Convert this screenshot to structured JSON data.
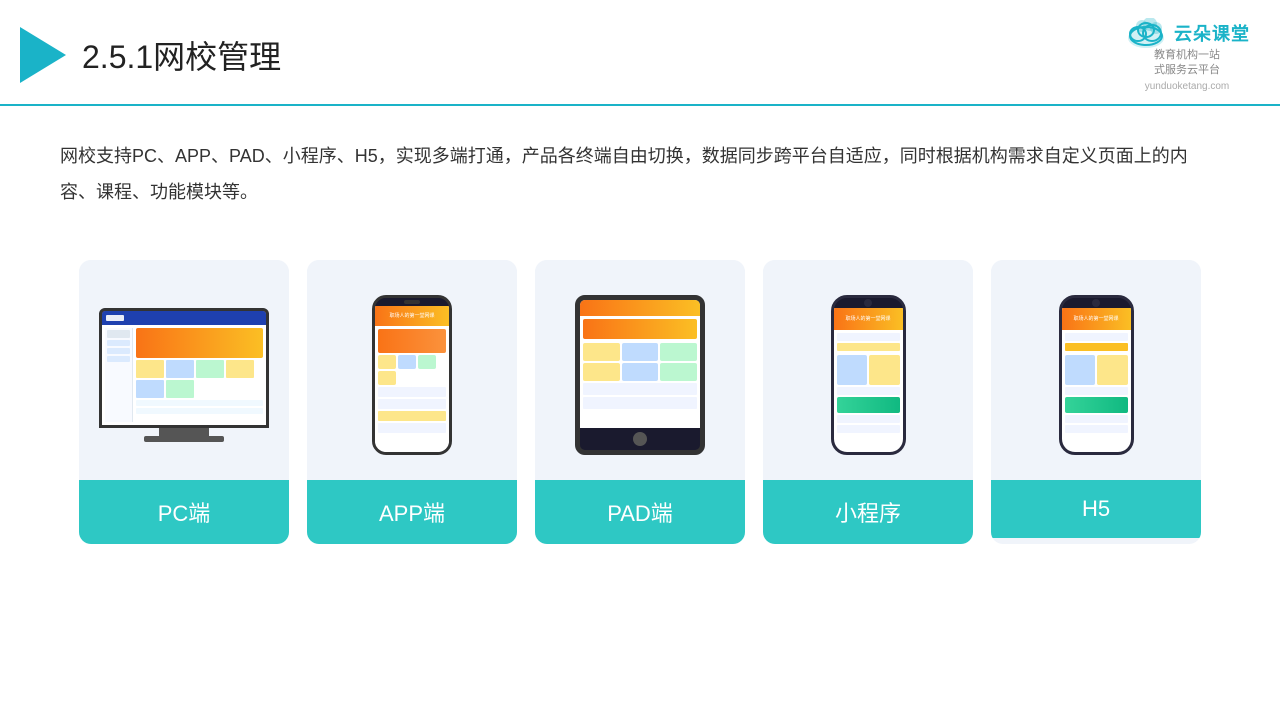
{
  "header": {
    "title_num": "2.5.1",
    "title_text": "网校管理",
    "logo_main": "云朵课堂",
    "logo_url": "yunduoketang.com",
    "logo_tagline_1": "教育机构一站",
    "logo_tagline_2": "式服务云平台"
  },
  "description": {
    "text": "网校支持PC、APP、PAD、小程序、H5，实现多端打通，产品各终端自由切换，数据同步跨平台自适应，同时根据机构需求自定义页面上的内容、课程、功能模块等。"
  },
  "cards": [
    {
      "id": "pc",
      "label": "PC端"
    },
    {
      "id": "app",
      "label": "APP端"
    },
    {
      "id": "pad",
      "label": "PAD端"
    },
    {
      "id": "mini",
      "label": "小程序"
    },
    {
      "id": "h5",
      "label": "H5"
    }
  ],
  "colors": {
    "accent": "#2ec8c4",
    "header_line": "#1ab3c8",
    "card_bg": "#f0f4fa",
    "text_dark": "#222222",
    "text_body": "#333333"
  }
}
